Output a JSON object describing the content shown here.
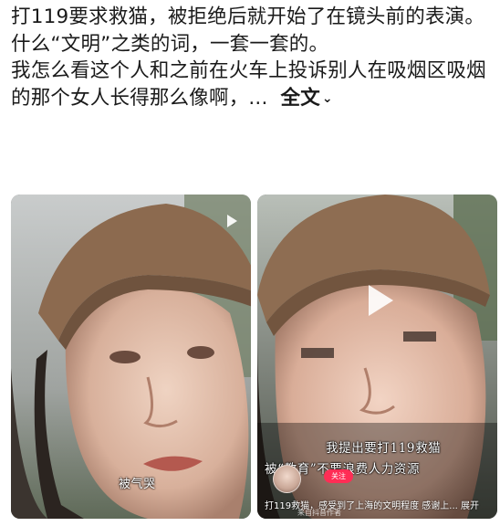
{
  "post": {
    "line1": "打119要求救猫，被拒绝后就开始了在镜头前的表演。",
    "line2": "什么“文明”之类的词，一套一套的。",
    "line3": "我怎么看这个人和之前在火车上投诉别人在吸烟区吸烟的那个女人长得那么像啊，...",
    "expand_label": "全文",
    "expand_icon": "chevron-down-icon"
  },
  "media_left": {
    "caption": "被气哭",
    "play_icon": "play-icon"
  },
  "media_right": {
    "overlay_line1": "我提出要打119救猫",
    "overlay_line2": "被“教育”不要浪费人力资源",
    "follow_label": "关注",
    "bottom_caption": "打119救猫，感受到了上海的文明程度 感谢上... 展开",
    "watermark": "来自抖音作者",
    "play_icon": "play-icon"
  }
}
